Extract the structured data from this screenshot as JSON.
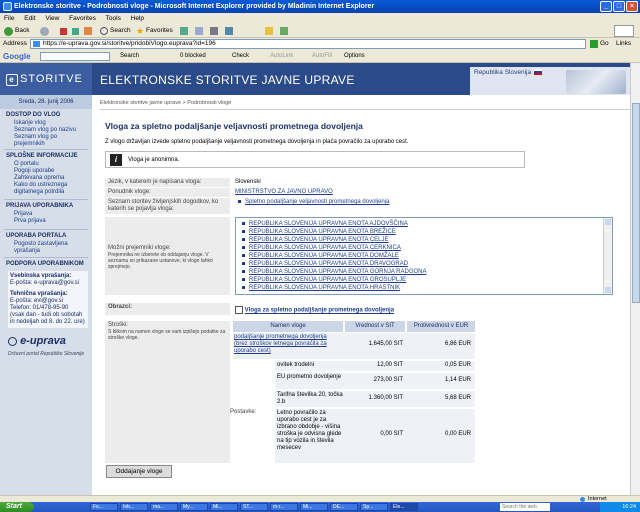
{
  "window": {
    "title": "Elektronske storitve - Podrobnosti vloge - Microsoft Internet Explorer provided by Mladinin Internet Explorer"
  },
  "menu": [
    "File",
    "Edit",
    "View",
    "Favorites",
    "Tools",
    "Help"
  ],
  "toolbar": {
    "back": "Back",
    "search": "Search",
    "favorites": "Favorites"
  },
  "address": {
    "label": "Address",
    "url": "https://e-uprava.gov.si/storitve/pridobiVlogo.euprava?id=196",
    "go": "Go",
    "links": "Links"
  },
  "googlebar": {
    "search_btn": "Search",
    "blocked": "0 blocked",
    "check": "Check",
    "autolink": "AutoLink",
    "autofill": "AutoFill",
    "options": "Options"
  },
  "header": {
    "logo": "STORITVE",
    "logo_letter": "e",
    "title": "ELEKTRONSKE STORITVE JAVNE UPRAVE",
    "republic": "Republika Slovenija"
  },
  "sidebar": {
    "date": "Sreda, 28. junij 2006",
    "sections": [
      {
        "title": "DOSTOP DO VLOG",
        "items": [
          "Iskanje vlog",
          "Seznam vlog po nazivu",
          "Seznam vlog po prejemnikih"
        ]
      },
      {
        "title": "SPLOŠNE INFORMACIJE",
        "items": [
          "O portalu",
          "Pogoji uporabe",
          "Zahtevana oprema",
          "Kako do ustreznega digitalnega potrdila"
        ]
      },
      {
        "title": "PRIJAVA UPORABNIKA",
        "items": [
          "Prijava",
          "Prva prijava"
        ]
      },
      {
        "title": "UPORABA PORTALA",
        "items": [
          "Pogosto zastavljena vprašanja"
        ]
      },
      {
        "title": "PODPORA UPORABNIKOM",
        "items": []
      }
    ],
    "support": {
      "general_label": "Vsebinska vprašanja:",
      "general_mail": "E-pošta: e-uprava@gov.si",
      "tech_label": "Tehnična vprašanja:",
      "tech_mail": "E-pošta: evi@gov.si",
      "tech_phone": "Telefon: 01/478-95-90",
      "tech_hours": "(vsak dan - tudi ob sobotah in nedeljah od 8. do 22. ure)"
    },
    "euprava_logo": "e-uprava",
    "euprava_sub": "Državni portal Republike Slovenije"
  },
  "breadcrumb": "Elektronske storitve javne uprave > Podrobnosti vloge",
  "main": {
    "heading": "Vloga za spletno podaljšanje veljavnosti prometnega dovoljenja",
    "intro": "Z vlogo državljan izvede spletno podaljšanje veljavnosti prometnega dovoljenja in plača povračilo za uporabo cest.",
    "anon_notice": "Vloga je anonimna.",
    "lang_label": "Jezik, v katerem je napisana vloga:",
    "lang_value": "Slovenski",
    "provider_label": "Ponudnik vloge:",
    "provider_value": "MINISTRSTVO ZA JAVNO UPRAVO",
    "events_label": "Seznam storitev življenjskih dogodkov, ko katerih se pojavlja vloga:",
    "events_value": "Spletno podaljšanje veljavnosti prometnega dovoljenja",
    "recipients_label": "Možni prejemniki vloge:",
    "recipients_note": "Prejemnika ne izberete ob oddajanju vloge. V seznamu so prikazane ustanove, ki vlogo lahko sprejmejo.",
    "recipients": [
      "REPUBLIKA SLOVENIJA UPRAVNA ENOTA AJDOVŠČINA",
      "REPUBLIKA SLOVENIJA UPRAVNA ENOTA BREŽICE",
      "REPUBLIKA SLOVENIJA UPRAVNA ENOTA CELJE",
      "REPUBLIKA SLOVENIJA UPRAVNA ENOTA CERKNICA",
      "REPUBLIKA SLOVENIJA UPRAVNA ENOTA DOMŽALE",
      "REPUBLIKA SLOVENIJA UPRAVNA ENOTA DRAVOGRAD",
      "REPUBLIKA SLOVENIJA UPRAVNA ENOTA GORNJA RADGONA",
      "REPUBLIKA SLOVENIJA UPRAVNA ENOTA GROSUPLJE",
      "REPUBLIKA SLOVENIJA UPRAVNA ENOTA HRASTNIK"
    ],
    "forms_label": "Obrazci:",
    "forms_value": "Vloga za spletno podaljšanje prometnega dovoljenja",
    "costs_label": "Stroški:",
    "costs_note": "S klikom na namen vloge se vam izpišejo podatke za stroške vloge.",
    "fees_label": "Postavke:",
    "cost_headers": [
      "Namen vloge",
      "Vrednost v SIT",
      "Protivrednost v EUR"
    ],
    "cost_rows": [
      {
        "name": "podaljšanje prometnega dovoljenja (brez stroškov letnega povračila za uporabo cest)",
        "sit": "1.645,00 SIT",
        "eur": "6,86 EUR"
      },
      {
        "name": "ovitek trodelni",
        "sit": "12,00 SIT",
        "eur": "0,05 EUR"
      },
      {
        "name": "EU prometno dovoljenje",
        "sit": "273,00 SIT",
        "eur": "1,14 EUR"
      },
      {
        "name": "Tarifna številka 20, točka 2.b",
        "sit": "1.360,00 SIT",
        "eur": "5,68 EUR"
      },
      {
        "name": "Letno povračilo za uporabo cest je za izbrano obdobje - višina stroška je odvisna glede na tip vozila in števila mesecev",
        "sit": "0,00 SIT",
        "eur": "0,00 EUR"
      }
    ],
    "submit": "Oddajanje vloge"
  },
  "status": {
    "text": "Internet"
  },
  "taskbar": {
    "start": "Start",
    "items": [
      "Fo...",
      "Inb...",
      "ma...",
      "My...",
      "Mi...",
      "ST...",
      "m-r...",
      "Mi...",
      "DE...",
      "Sp...",
      "Ele..."
    ],
    "search": "Search the web",
    "clock": "16:24"
  }
}
